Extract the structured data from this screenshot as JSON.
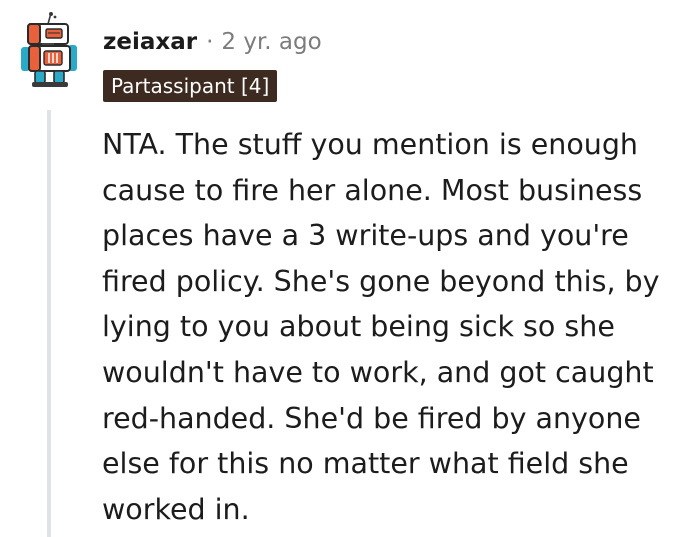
{
  "comment": {
    "author": "zeiaxar",
    "separator": "·",
    "timestamp": "2 yr. ago",
    "flair": "Partassipant [4]",
    "body": "NTA. The stuff you mention is enough cause to fire her alone. Most business places have a 3 write-ups and you're fired policy. She's gone beyond this, by lying to you about being sick so she wouldn't have to work, and got caught red-handed. She'd be fired by anyone else for this no matter what field she worked in."
  },
  "colors": {
    "flair_background": "#3d2b21",
    "flair_text": "#ffffff",
    "meta_gray": "#7c7c7c",
    "thread_line": "#dfe2e6",
    "text": "#1c1c1c"
  },
  "icons": {
    "avatar": "robot-avatar-icon"
  }
}
